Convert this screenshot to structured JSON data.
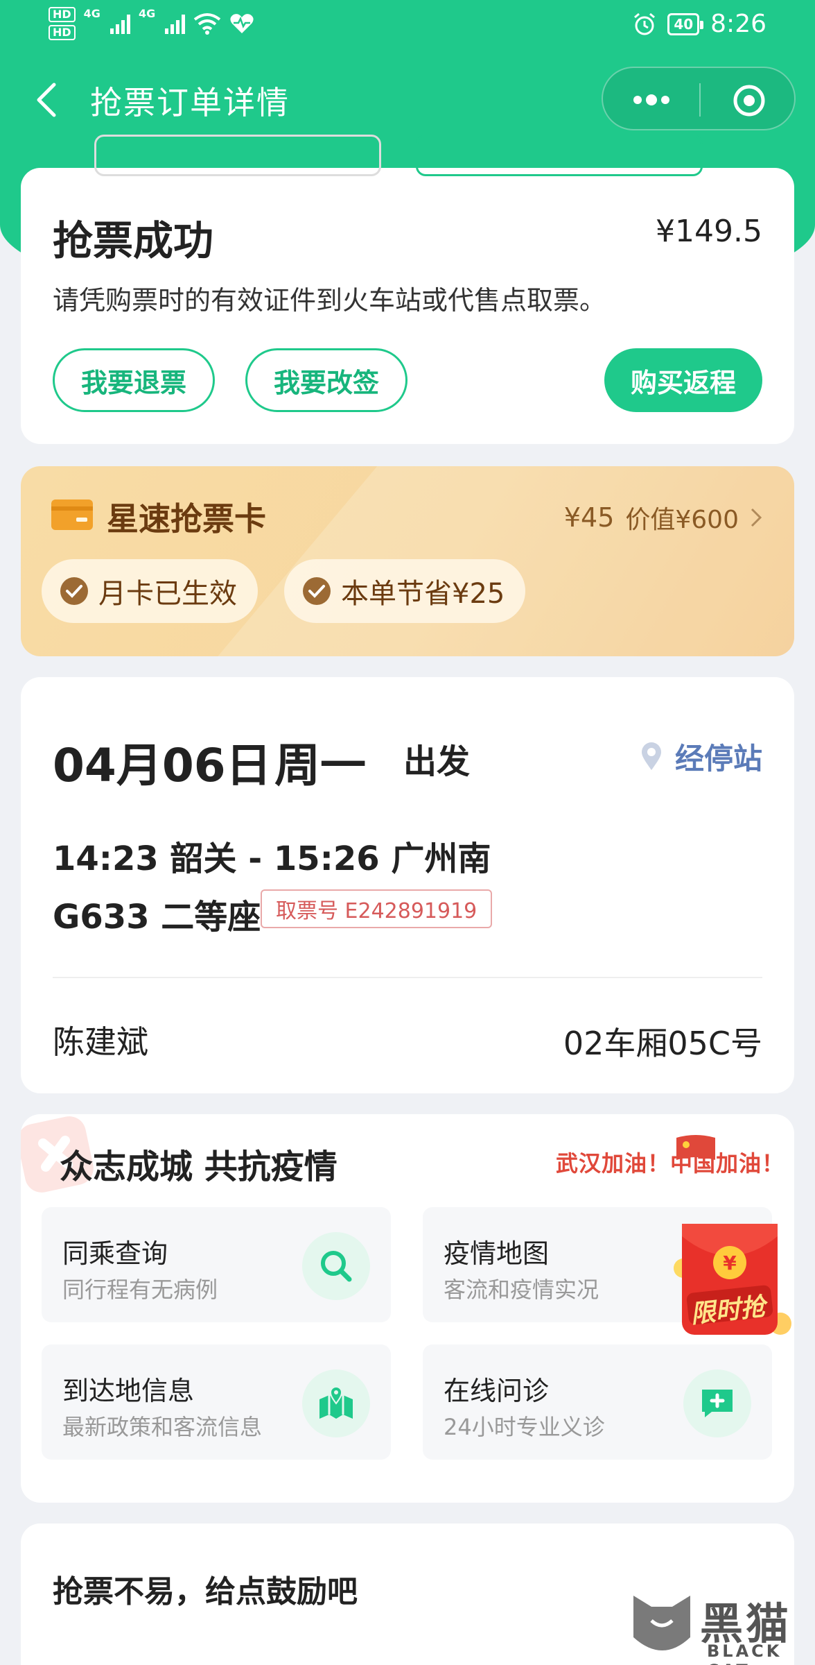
{
  "status_bar": {
    "hd1": "HD",
    "hd2": "HD",
    "net1": "4G",
    "net2": "4G",
    "battery": "40",
    "time": "8:26"
  },
  "nav": {
    "title": "抢票订单详情"
  },
  "order": {
    "status_title": "抢票成功",
    "price": "¥149.5",
    "desc": "请凭购票时的有效证件到火车站或代售点取票。",
    "refund_label": "我要退票",
    "change_label": "我要改签",
    "return_label": "购买返程"
  },
  "speed_card": {
    "title": "星速抢票卡",
    "price": "¥45",
    "value": "价值¥600",
    "badge1": "月卡已生效",
    "badge2": "本单节省¥25"
  },
  "trip": {
    "date": "04月06日",
    "weekday": "周一",
    "depart_label": "出发",
    "stops_label": "经停站",
    "route": "14:23 韶关 - 15:26 广州南",
    "train": "G633  二等座",
    "ticket_no": "取票号 E242891919",
    "passenger": "陈建斌",
    "seat": "02车厢05C号"
  },
  "epidemic": {
    "title": "众志成城 共抗疫情",
    "slogan": "武汉加油！中国加油！",
    "services": [
      {
        "title": "同乘查询",
        "sub": "同行程有无病例"
      },
      {
        "title": "疫情地图",
        "sub": "客流和疫情实况"
      },
      {
        "title": "到达地信息",
        "sub": "最新政策和客流信息"
      },
      {
        "title": "在线问诊",
        "sub": "24小时专业义诊"
      }
    ],
    "redpacket_label": "限时抢"
  },
  "encourage": {
    "title": "抢票不易，给点鼓励吧"
  },
  "watermark": {
    "name": "黑猫",
    "sub": "BLACK CAT"
  },
  "colors": {
    "brand_green": "#1fc98b",
    "gold_text": "#6b3b10",
    "link_blue": "#5b7bb8",
    "ticket_red": "#d65a5a"
  }
}
